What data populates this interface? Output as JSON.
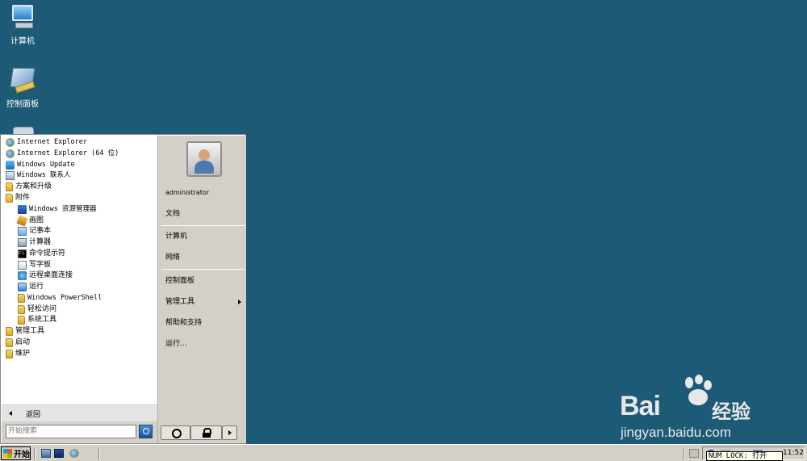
{
  "desktop": {
    "icons": [
      {
        "label": "计算机"
      },
      {
        "label": "控制面板"
      }
    ]
  },
  "start_menu": {
    "programs": [
      {
        "label": "Internet Explorer",
        "icon": "ie-icon"
      },
      {
        "label": "Internet Explorer (64 位)",
        "icon": "ie-icon"
      },
      {
        "label": "Windows Update",
        "icon": "windows-update-icon"
      },
      {
        "label": "Windows 联系人",
        "icon": "contacts-icon"
      },
      {
        "label": "方案和升级",
        "icon": "folder-icon"
      },
      {
        "label": "附件",
        "icon": "folder-icon"
      },
      {
        "label": "Windows 资源管理器",
        "icon": "explorer-icon"
      },
      {
        "label": "画图",
        "icon": "paint-icon"
      },
      {
        "label": "记事本",
        "icon": "notepad-icon"
      },
      {
        "label": "计算器",
        "icon": "calculator-icon"
      },
      {
        "label": "命令提示符",
        "icon": "cmd-icon"
      },
      {
        "label": "写字板",
        "icon": "wordpad-icon"
      },
      {
        "label": "远程桌面连接",
        "icon": "remote-desktop-icon"
      },
      {
        "label": "运行",
        "icon": "run-icon"
      },
      {
        "label": "Windows PowerShell",
        "icon": "folder-icon"
      },
      {
        "label": "轻松访问",
        "icon": "folder-icon"
      },
      {
        "label": "系统工具",
        "icon": "folder-icon"
      },
      {
        "label": "管理工具",
        "icon": "folder-icon"
      },
      {
        "label": "启动",
        "icon": "folder-icon"
      },
      {
        "label": "维护",
        "icon": "folder-icon"
      }
    ],
    "back_label": "返回",
    "search_placeholder": "开始搜索",
    "user_name": "administrator",
    "right_items": {
      "documents": "文档",
      "computer": "计算机",
      "network": "网络",
      "control_panel": "控制面板",
      "admin_tools": "管理工具",
      "help": "帮助和支持",
      "run": "运行..."
    }
  },
  "taskbar": {
    "start_label": "开始",
    "numlock_tooltip": "NUM LOCK: 打开",
    "clock": "11:52"
  },
  "watermark": {
    "logo": "Bai",
    "logo_suffix": "经验",
    "url": "jingyan.baidu.com"
  },
  "colors": {
    "desktop_background": "#1c5a76",
    "menu_right_pane": "#d4d0c8"
  }
}
